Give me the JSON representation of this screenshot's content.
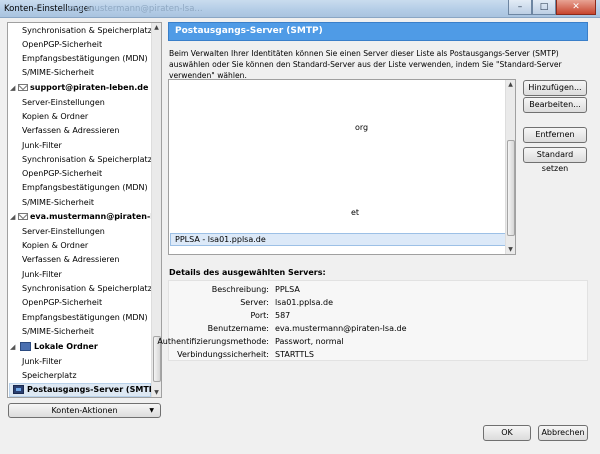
{
  "window": {
    "title": "Konten-Einstellungen",
    "background_title": "eva.mustermann@piraten-lsa..."
  },
  "sidebar": {
    "items": [
      {
        "label": "Synchronisation & Speicherplatz",
        "kind": "child"
      },
      {
        "label": "OpenPGP-Sicherheit",
        "kind": "child"
      },
      {
        "label": "Empfangsbestätigungen (MDN)",
        "kind": "child"
      },
      {
        "label": "S/MIME-Sicherheit",
        "kind": "child"
      },
      {
        "label": "support@piraten-leben.de",
        "kind": "account"
      },
      {
        "label": "Server-Einstellungen",
        "kind": "child"
      },
      {
        "label": "Kopien & Ordner",
        "kind": "child"
      },
      {
        "label": "Verfassen & Adressieren",
        "kind": "child"
      },
      {
        "label": "Junk-Filter",
        "kind": "child"
      },
      {
        "label": "Synchronisation & Speicherplatz",
        "kind": "child"
      },
      {
        "label": "OpenPGP-Sicherheit",
        "kind": "child"
      },
      {
        "label": "Empfangsbestätigungen (MDN)",
        "kind": "child"
      },
      {
        "label": "S/MIME-Sicherheit",
        "kind": "child"
      },
      {
        "label": "eva.mustermann@piraten-lsa.de",
        "kind": "account"
      },
      {
        "label": "Server-Einstellungen",
        "kind": "child"
      },
      {
        "label": "Kopien & Ordner",
        "kind": "child"
      },
      {
        "label": "Verfassen & Adressieren",
        "kind": "child"
      },
      {
        "label": "Junk-Filter",
        "kind": "child"
      },
      {
        "label": "Synchronisation & Speicherplatz",
        "kind": "child"
      },
      {
        "label": "OpenPGP-Sicherheit",
        "kind": "child"
      },
      {
        "label": "Empfangsbestätigungen (MDN)",
        "kind": "child"
      },
      {
        "label": "S/MIME-Sicherheit",
        "kind": "child"
      },
      {
        "label": "Lokale Ordner",
        "kind": "local"
      },
      {
        "label": "Junk-Filter",
        "kind": "child"
      },
      {
        "label": "Speicherplatz",
        "kind": "child"
      },
      {
        "label": "Postausgangs-Server (SMTP)",
        "kind": "selected"
      }
    ],
    "account_actions_label": "Konten-Aktionen"
  },
  "panel": {
    "header": "Postausgangs-Server (SMTP)",
    "description": "Beim Verwalten Ihrer Identitäten können Sie einen Server dieser Liste als Postausgangs-Server (SMTP) auswählen oder Sie können den Standard-Server aus der Liste verwenden, indem Sie \"Standard-Server verwenden\" wählen.",
    "server_fragments": [
      "org",
      "et"
    ],
    "selected_server": "PPLSA - lsa01.pplsa.de",
    "buttons": {
      "add": "Hinzufügen...",
      "edit": "Bearbeiten...",
      "remove": "Entfernen",
      "set_default": "Standard setzen"
    },
    "details_label": "Details des ausgewählten Servers:",
    "details": [
      {
        "key": "Beschreibung:",
        "value": "PPLSA"
      },
      {
        "key": "Server:",
        "value": "lsa01.pplsa.de"
      },
      {
        "key": "Port:",
        "value": "587"
      },
      {
        "key": "Benutzername:",
        "value": "eva.mustermann@piraten-lsa.de"
      },
      {
        "key": "Authentifizierungsmethode:",
        "value": "Passwort, normal"
      },
      {
        "key": "Verbindungssicherheit:",
        "value": "STARTTLS"
      }
    ]
  },
  "footer": {
    "ok": "OK",
    "cancel": "Abbrechen"
  }
}
